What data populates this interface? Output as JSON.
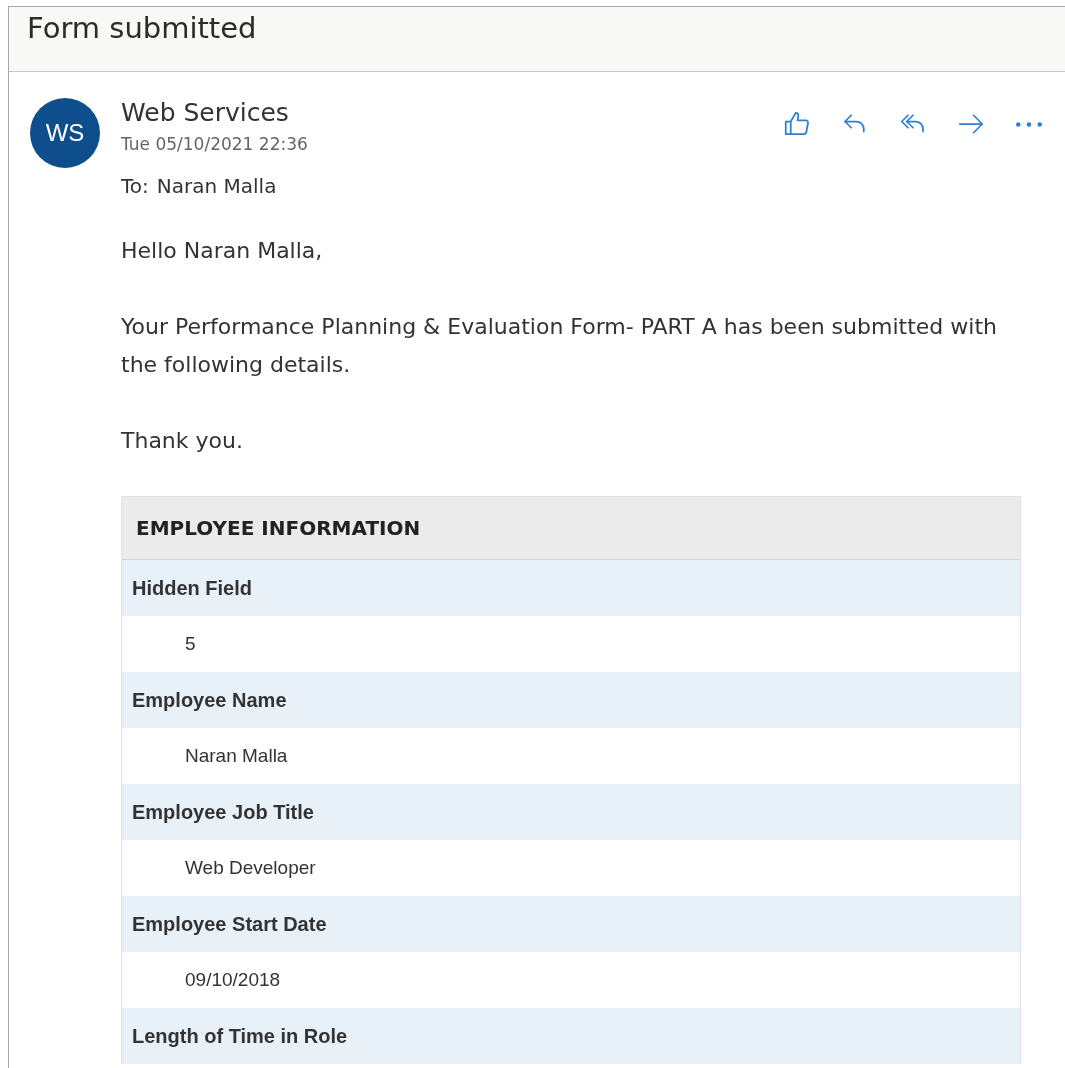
{
  "window": {
    "title": "Form submitted"
  },
  "message": {
    "avatar_initials": "WS",
    "sender": "Web Services",
    "date": "Tue 05/10/2021 22:36",
    "to_label": "To:",
    "to": "Naran Malla",
    "paragraphs": [
      "Hello Naran Malla,",
      "Your Performance Planning & Evaluation Form- PART A has been submitted with the following details.",
      "Thank you."
    ]
  },
  "table": {
    "title": "EMPLOYEE INFORMATION",
    "rows": [
      {
        "label": "Hidden Field",
        "value": "5"
      },
      {
        "label": "Employee Name",
        "value": "Naran Malla"
      },
      {
        "label": "Employee Job Title",
        "value": "Web Developer"
      },
      {
        "label": "Employee Start Date",
        "value": "09/10/2018"
      },
      {
        "label": "Length of Time in Role"
      }
    ]
  }
}
